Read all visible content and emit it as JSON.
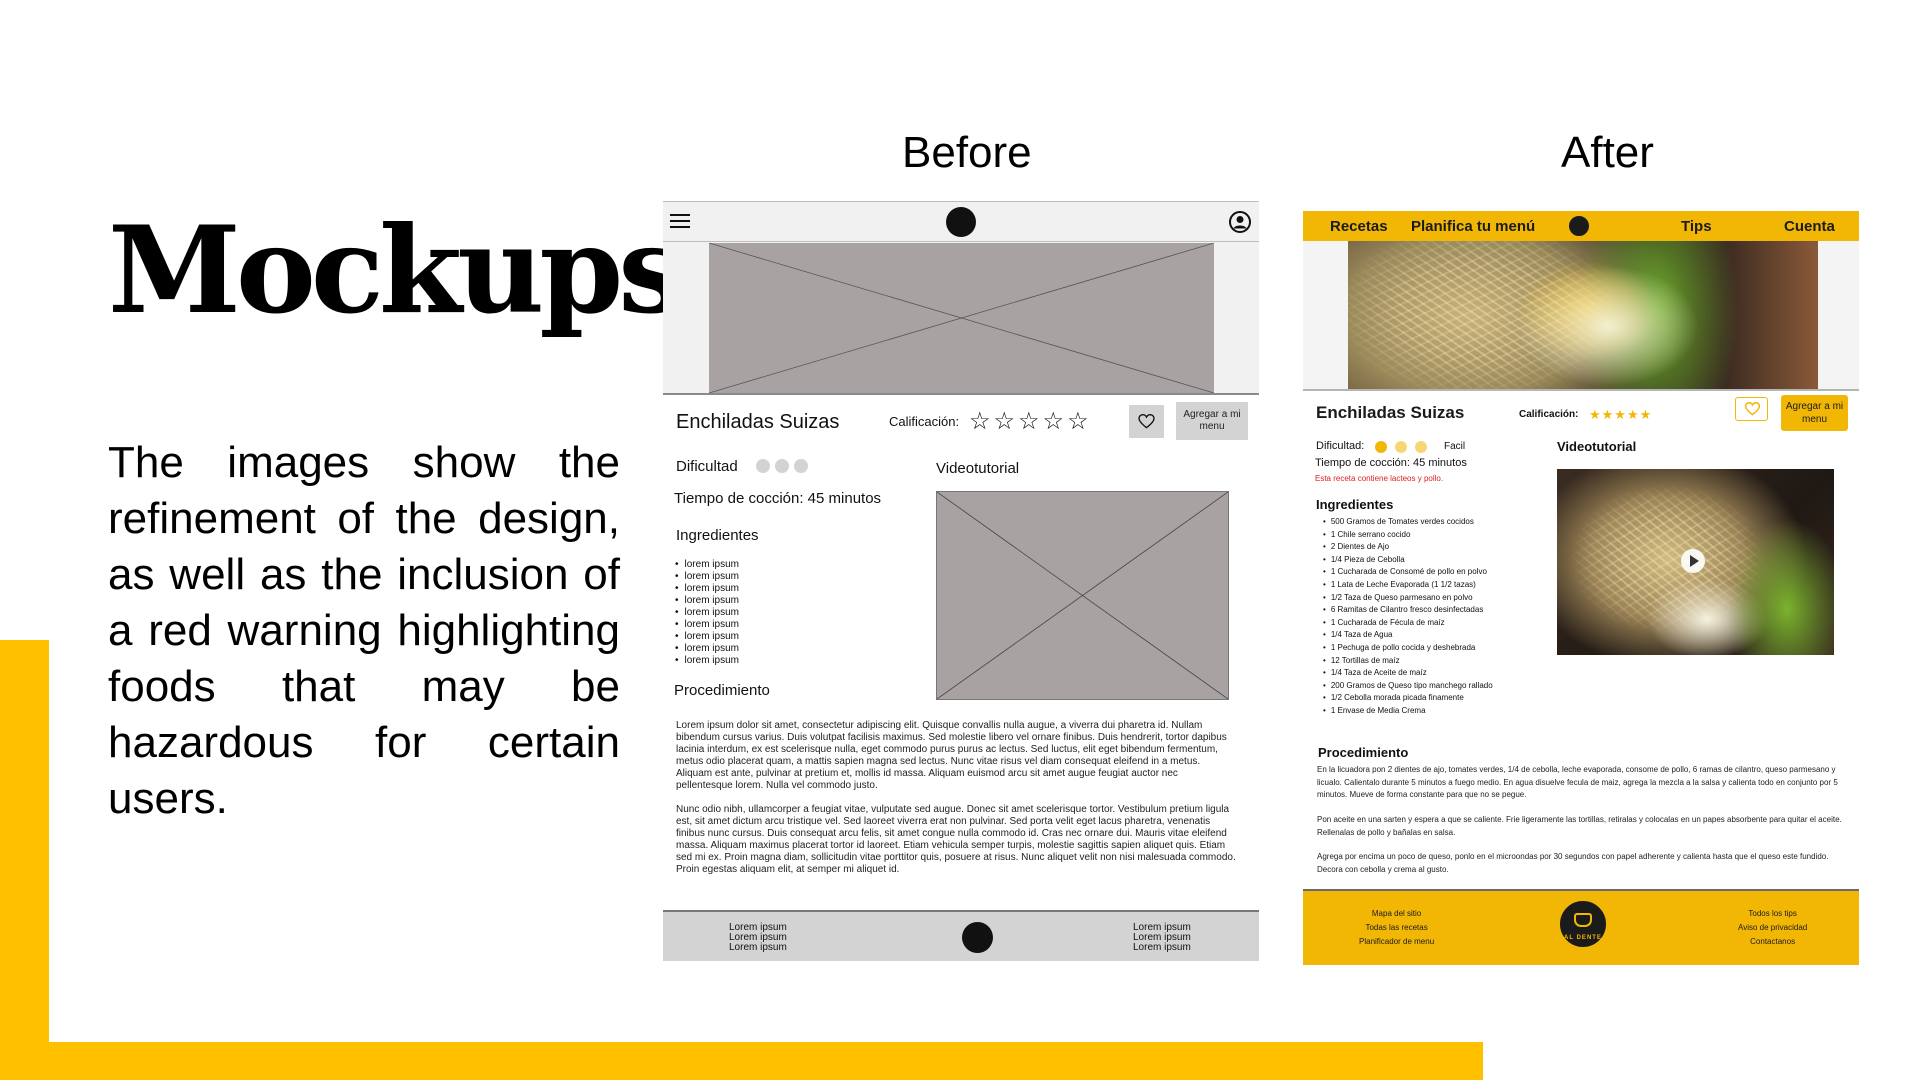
{
  "slide": {
    "title": "Mockups",
    "body": "The images show the refinement of the design, as well as the inclusion of a red warning highlighting foods that may be hazardous for certain users.",
    "before_label": "Before",
    "after_label": "After",
    "accent_color": "#FFC000"
  },
  "before": {
    "recipe_title": "Enchiladas Suizas",
    "rating_label": "Calificación:",
    "stars": "☆☆☆☆☆",
    "add_to_menu": "Agregar a mi menu",
    "difficulty_label": "Dificultad",
    "cook_time": "Tiempo de cocción: 45 minutos",
    "ingredients_title": "Ingredientes",
    "ingredients": [
      "lorem ipsum",
      "lorem ipsum",
      "lorem ipsum",
      "lorem ipsum",
      "lorem ipsum",
      "lorem ipsum",
      "lorem ipsum",
      "lorem ipsum",
      "lorem ipsum"
    ],
    "procedure_title": "Procedimiento",
    "video_title": "Videotutorial",
    "paragraph_1": "Lorem ipsum dolor sit amet, consectetur adipiscing elit. Quisque convallis nulla augue, a viverra dui pharetra id. Nullam bibendum cursus varius. Duis volutpat facilisis maximus. Sed molestie libero vel ornare finibus. Duis hendrerit, tortor dapibus lacinia interdum, ex est scelerisque nulla, eget commodo purus purus ac lectus. Sed luctus, elit eget bibendum fermentum, metus odio placerat quam, a mattis sapien magna sed lectus. Nunc vitae risus vel diam consequat eleifend in a metus. Aliquam est ante, pulvinar at pretium et, mollis id massa. Aliquam euismod arcu sit amet augue feugiat auctor nec pellentesque lorem. Nulla vel commodo justo.",
    "paragraph_2": "Nunc odio nibh, ullamcorper a feugiat vitae, vulputate sed augue. Donec sit amet scelerisque tortor. Vestibulum pretium ligula est, sit amet dictum arcu tristique vel. Sed laoreet viverra erat non pulvinar. Sed porta velit eget lacus pharetra, venenatis finibus nunc cursus. Duis consequat arcu felis, sit amet congue nulla commodo id. Cras nec ornare dui. Mauris vitae eleifend massa. Aliquam maximus placerat tortor id laoreet. Etiam vehicula semper turpis, molestie sagittis sapien aliquet quis. Etiam sed mi ex. Proin magna diam, sollicitudin vitae porttitor quis, posuere at risus. Nunc aliquet velit non nisi malesuada commodo. Proin egestas aliquam elit, at semper mi aliquet id.",
    "footer_left": [
      "Lorem ipsum",
      "Lorem ipsum",
      "Lorem ipsum"
    ],
    "footer_right": [
      "Lorem ipsum",
      "Lorem ipsum",
      "Lorem ipsum"
    ]
  },
  "after": {
    "nav": [
      "Recetas",
      "Planifica tu menú",
      "Tips",
      "Cuenta"
    ],
    "recipe_title": "Enchiladas Suizas",
    "rating_label": "Calificación:",
    "stars": "★★★★★",
    "add_to_menu": "Agregar a mi menu",
    "difficulty_label": "Dificultad:",
    "difficulty_value": "Facil",
    "difficulty_level": 1,
    "difficulty_max": 3,
    "cook_time": "Tiempo de cocción: 45 minutos",
    "warning": "Esta receta contiene lacteos y pollo.",
    "ingredients_title": "Ingredientes",
    "ingredients": [
      "500 Gramos de Tomates verdes cocidos",
      "1 Chile serrano cocido",
      "2 Dientes de Ajo",
      "1/4 Pieza de Cebolla",
      "1 Cucharada de Consomé de pollo en polvo",
      "1 Lata de Leche Evaporada (1 1/2 tazas)",
      "1/2 Taza de Queso parmesano en polvo",
      "6 Ramitas de Cilantro fresco desinfectadas",
      "1 Cucharada de Fécula de maíz",
      "1/4 Taza de Agua",
      "1 Pechuga de pollo cocida y deshebrada",
      "12 Tortillas de maíz",
      "1/4 Taza de Aceite de maíz",
      "200 Gramos de Queso tipo manchego rallado",
      "1/2 Cebolla morada picada finamente",
      "1 Envase de Media Crema"
    ],
    "video_title": "Videotutorial",
    "procedure_title": "Procedimiento",
    "steps": [
      "En la licuadora pon 2 dientes de ajo, tomates verdes, 1/4 de cebolla, leche evaporada, consome de pollo, 6 ramas de cilantro, queso parmesano y licualo. Calientalo durante 5 minutos a fuego medio. En agua disuelve fecula de maiz, agrega la mezcla a la salsa y calienta todo en conjunto por 5 minutos. Mueve de forma constante para que no se pegue.",
      "Pon aceite en una sarten y espera a que se caliente. Frie ligeramente las tortillas, retiralas y colocalas en un papes absorbente para quitar el aceite. Rellenalas de pollo y bañalas en salsa.",
      "Agrega por encima un poco de queso, ponlo en el microondas por 30 segundos con papel adherente y calienta hasta que el queso este fundido. Decora con cebolla y crema al gusto."
    ],
    "footer_left": [
      "Mapa del sitio",
      "Todas las recetas",
      "Planificador de menu"
    ],
    "footer_right": [
      "Todos los tips",
      "Aviso de privacidad",
      "Contactanos"
    ],
    "footer_logo_text": "AL DENTE",
    "brand_color": "#F2B705",
    "warning_color": "#E02020"
  }
}
